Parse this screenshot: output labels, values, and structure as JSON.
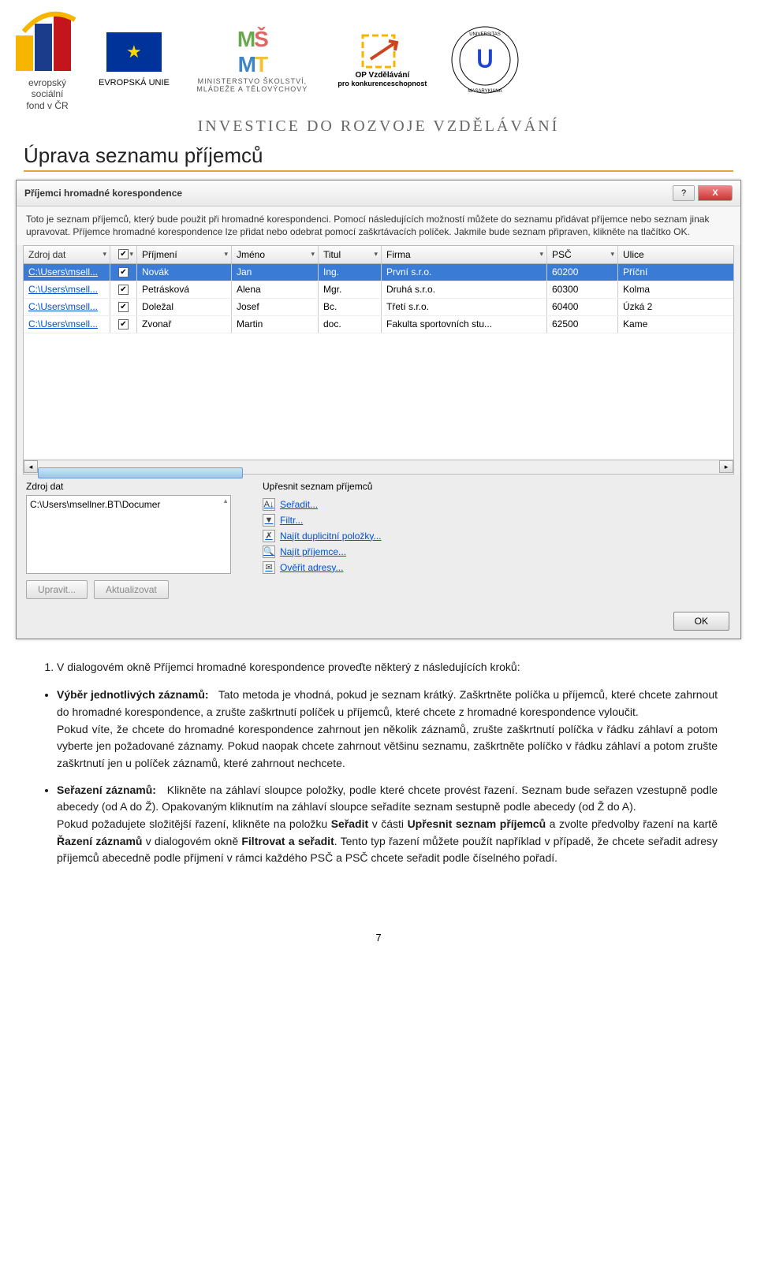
{
  "logos": {
    "esf_line1": "evropský",
    "esf_line2": "sociální",
    "esf_line3": "fond v ČR",
    "eu_label": "EVROPSKÁ UNIE",
    "msmt_abbrev": "MŠMT",
    "msmt_line1": "MINISTERSTVO ŠKOLSTVÍ,",
    "msmt_line2": "MLÁDEŽE A TĚLOVÝCHOVY",
    "op_line1": "OP Vzdělávání",
    "op_line2": "pro konkurenceschopnost"
  },
  "tagline": "INVESTICE DO ROZVOJE VZDĚLÁVÁNÍ",
  "page_title": "Úprava seznamu příjemců",
  "dialog": {
    "title": "Příjemci hromadné korespondence",
    "help": "?",
    "close": "X",
    "desc": "Toto je seznam příjemců, který bude použit při hromadné korespondenci. Pomocí následujících možností můžete do seznamu přidávat příjemce nebo seznam jinak upravovat. Příjemce hromadné korespondence lze přidat nebo odebrat pomocí zaškrtávacích políček. Jakmile bude seznam připraven, klikněte na tlačítko OK.",
    "headers": [
      "Zdroj dat",
      "",
      "Příjmení",
      "Jméno",
      "Titul",
      "Firma",
      "PSČ",
      "Ulice"
    ],
    "rows": [
      {
        "src": "C:\\Users\\msell...",
        "chk": true,
        "f0": "Novák",
        "f1": "Jan",
        "f2": "Ing.",
        "f3": "První s.r.o.",
        "f4": "60200",
        "f5": "Příční",
        "sel": true
      },
      {
        "src": "C:\\Users\\msell...",
        "chk": true,
        "f0": "Petrásková",
        "f1": "Alena",
        "f2": "Mgr.",
        "f3": "Druhá s.r.o.",
        "f4": "60300",
        "f5": "Kolma"
      },
      {
        "src": "C:\\Users\\msell...",
        "chk": true,
        "f0": "Doležal",
        "f1": "Josef",
        "f2": "Bc.",
        "f3": "Třetí s.r.o.",
        "f4": "60400",
        "f5": "Úzká 2"
      },
      {
        "src": "C:\\Users\\msell...",
        "chk": true,
        "f0": "Zvonař",
        "f1": "Martin",
        "f2": "doc.",
        "f3": "Fakulta sportovních stu...",
        "f4": "62500",
        "f5": "Kame"
      }
    ],
    "source_label": "Zdroj dat",
    "source_path": "C:\\Users\\msellner.BT\\Documer",
    "refine_label": "Upřesnit seznam příjemců",
    "links": {
      "sort": "Seřadit...",
      "filter": "Filtr...",
      "dup": "Najít duplicitní položky...",
      "find": "Najít příjemce...",
      "verify": "Ověřit adresy..."
    },
    "edit_btn": "Upravit...",
    "refresh_btn": "Aktualizovat",
    "ok": "OK"
  },
  "body": {
    "lead": "V dialogovém okně Příjemci hromadné korespondence proveďte některý z následujících kroků:",
    "b1_label": "Výběr jednotlivých záznamů:",
    "b1_text1": "Tato metoda je vhodná, pokud je seznam krátký. Zaškrtněte políčka u příjemců, které chcete zahrnout do hromadné korespondence, a zrušte zaškrtnutí políček u příjemců, které chcete z hromadné korespondence vyloučit.",
    "b1_text2": "Pokud víte, že chcete do hromadné korespondence zahrnout jen několik záznamů, zrušte zaškrtnutí políčka v řádku záhlaví a potom vyberte jen požadované záznamy. Pokud naopak chcete zahrnout většinu seznamu, zaškrtněte políčko v řádku záhlaví a potom zrušte zaškrtnutí jen u políček záznamů, které zahrnout nechcete.",
    "b2_label": "Seřazení záznamů:",
    "b2_text1": "Klikněte na záhlaví sloupce položky, podle které chcete provést řazení. Seznam bude seřazen vzestupně podle abecedy (od A do Ž). Opakovaným kliknutím na záhlaví sloupce seřadíte seznam sestupně podle abecedy (od Ž do A).",
    "b2_text2a": "Pokud požadujete složitější řazení, klikněte na položku ",
    "b2_text2b": "Seřadit",
    "b2_text2c": " v části ",
    "b2_text2d": "Upřesnit seznam příjemců",
    "b2_text2e": " a zvolte předvolby řazení na kartě ",
    "b2_text2f": "Řazení záznamů",
    "b2_text2g": " v dialogovém okně ",
    "b2_text2h": "Filtrovat a seřadit",
    "b2_text2i": ". Tento typ řazení můžete použít například v případě, že chcete seřadit adresy příjemců abecedně podle příjmení v rámci každého PSČ a PSČ chcete seřadit podle číselného pořadí."
  },
  "pagenum": "7"
}
